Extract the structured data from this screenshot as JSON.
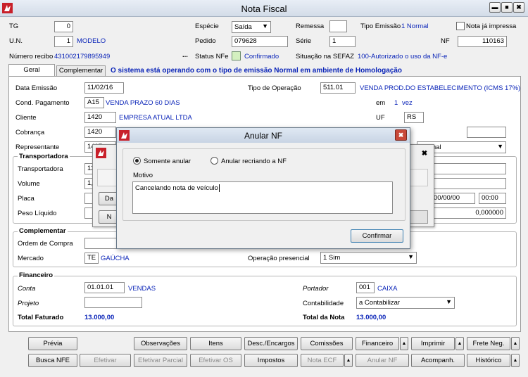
{
  "window": {
    "title": "Nota Fiscal",
    "min": "▬",
    "max": "■",
    "close": "✖"
  },
  "header": {
    "tg_label": "TG",
    "tg_value": "0",
    "especie_label": "Espécie",
    "especie_value": "Saída",
    "remessa_label": "Remessa",
    "tipo_emissao_label": "Tipo Emissão",
    "tipo_emissao_value": "1 Normal",
    "nota_impressa_label": "Nota já impressa",
    "un_label": "U.N.",
    "un_value": "1",
    "un_name": "MODELO",
    "pedido_label": "Pedido",
    "pedido_value": "079628",
    "serie_label": "Série",
    "serie_value": "1",
    "nf_label": "NF",
    "nf_value": "110163",
    "recibo_label": "Número recibo",
    "recibo_value": "431002179895949",
    "ellipsis": "...",
    "status_label": "Status NFe",
    "status_value": "Confirmado",
    "sefaz_label": "Situação na SEFAZ",
    "sefaz_value": "100-Autorizado o uso da NF-e"
  },
  "tabs": [
    {
      "label": "Geral"
    },
    {
      "label": "Complementar"
    }
  ],
  "banner": "O sistema está operando com o tipo de emissão Normal em ambiente de Homologação",
  "geral": {
    "data_emissao_label": "Data Emissão",
    "data_emissao_value": "11/02/16",
    "tipo_op_label": "Tipo de Operação",
    "tipo_op_code": "511.01",
    "tipo_op_desc": "VENDA PROD.DO ESTABELECIMENTO (ICMS 17%)",
    "cond_label": "Cond. Pagamento",
    "cond_code": "A15",
    "cond_desc": "VENDA PRAZO 60 DIAS",
    "em_label": "em",
    "em_value": "1",
    "vez": "vez",
    "cliente_label": "Cliente",
    "cliente_code": "1420",
    "cliente_name": "EMPRESA ATUAL LTDA",
    "uf_label": "UF",
    "uf_value": "RS",
    "cobranca_label": "Cobrança",
    "cobranca_code": "1420",
    "rep_label": "Representante",
    "rep_code": "1417",
    "rep_select": "Normal"
  },
  "transportadora": {
    "title": "Transportadora",
    "transp_label": "Transportadora",
    "transp_code": "13",
    "volume_label": "Volume",
    "volume_value": "1,",
    "placa_label": "Placa",
    "peso_label": "Peso Líquido",
    "date_value": "00/00/00",
    "time_value": "00:00",
    "peso_value": "0,000000"
  },
  "complementar": {
    "title": "Complementar",
    "ordem_label": "Ordem de Compra",
    "mercado_label": "Mercado",
    "mercado_code": "TE",
    "mercado_desc": "GAÚCHA",
    "op_presencial_label": "Operação presencial",
    "op_presencial_value": "1 Sim"
  },
  "financeiro": {
    "title": "Financeiro",
    "conta_label": "Conta",
    "conta_code": "01.01.01",
    "conta_desc": "VENDAS",
    "portador_label": "Portador",
    "portador_code": "001",
    "portador_desc": "CAIXA",
    "projeto_label": "Projeto",
    "contab_label": "Contabilidade",
    "contab_value": "a Contabilizar",
    "total_faturado_label": "Total Faturado",
    "total_faturado_value": "13.000,00",
    "total_nota_label": "Total da Nota",
    "total_nota_value": "13.000,00"
  },
  "buttons_row1": {
    "previa": "Prévia",
    "observacoes": "Observações",
    "itens": "Itens",
    "desc": "Desc./Encargos",
    "comissoes": "Comissões",
    "financeiro": "Financeiro",
    "imprimir": "Imprimir",
    "frete": "Frete Neg.",
    "up": "▲"
  },
  "buttons_row2": {
    "busca": "Busca NFE",
    "efetivar": "Efetivar",
    "efetivar_parcial": "Efetivar Parcial",
    "efetivar_os": "Efetivar OS",
    "impostos": "Impostos",
    "nota_ecf": "Nota ECF",
    "anular": "Anular NF",
    "acompanh": "Acompanh.",
    "historico": "Histórico"
  },
  "behind_dialog": {
    "btn_a": "Da",
    "btn_b": "N",
    "close": "✖"
  },
  "modal": {
    "title": "Anular NF",
    "close": "✖",
    "opt1": "Somente anular",
    "opt2": "Anular recriando a NF",
    "opt1_selected": true,
    "motivo_label": "Motivo",
    "motivo_value": "Cancelando nota de veículo",
    "confirm": "Confirmar"
  }
}
